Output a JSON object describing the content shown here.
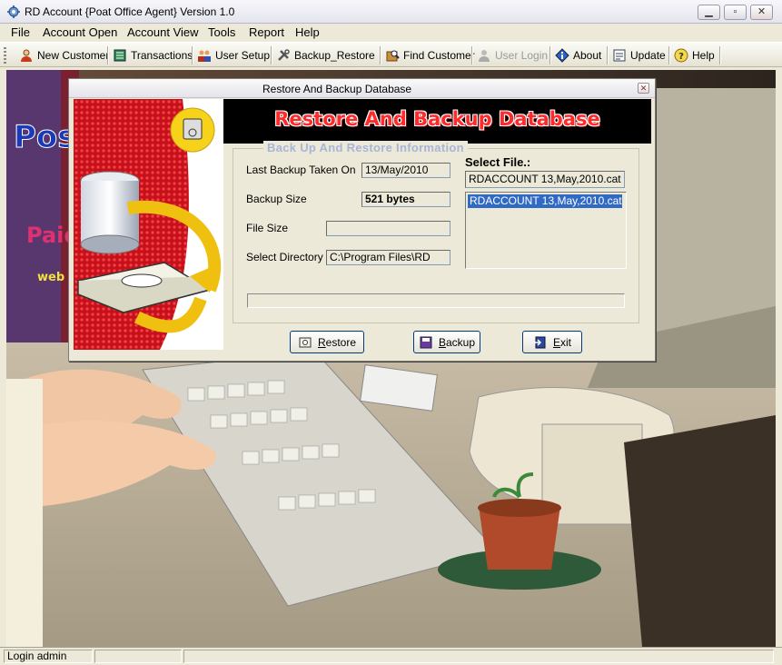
{
  "window": {
    "title": "RD Account {Poat Office Agent} Version 1.0",
    "min_glyph": "▁",
    "max_glyph": "▫",
    "close_glyph": "✕"
  },
  "menu": [
    "File",
    "Account Open",
    "Account View",
    "Tools",
    "Report",
    "Help"
  ],
  "toolbar": [
    {
      "label": "New Customer",
      "icon": "person-icon",
      "enabled": true
    },
    {
      "label": "Transactions",
      "icon": "ledger-icon",
      "enabled": true
    },
    {
      "label": "User Setup",
      "icon": "users-icon",
      "enabled": true
    },
    {
      "label": "Backup_Restore",
      "icon": "tools-icon",
      "enabled": true
    },
    {
      "label": "Find Customer",
      "icon": "find-icon",
      "enabled": true
    },
    {
      "label": "User Login",
      "icon": "user-login-icon",
      "enabled": false
    },
    {
      "label": "About",
      "icon": "info-icon",
      "enabled": true
    },
    {
      "label": "Update",
      "icon": "update-icon",
      "enabled": true
    },
    {
      "label": "Help",
      "icon": "help-icon",
      "enabled": true
    }
  ],
  "background_logo": {
    "line1": "Post",
    "line2": "Paid",
    "line3": "web"
  },
  "dialog": {
    "title": "Restore And Backup Database",
    "close_glyph": "✕",
    "banner": "Restore And Backup Database",
    "group_title": "Back Up And  Restore  Information",
    "fields": {
      "last_backup_label": "Last Backup Taken On",
      "last_backup_value": "13/May/2010",
      "backup_size_label": "Backup Size",
      "backup_size_value": "521 bytes",
      "file_size_label": "File Size",
      "file_size_value": "",
      "select_dir_label": "Select Directory",
      "select_dir_value": "C:\\Program Files\\RD"
    },
    "select_file_label": "Select File.:",
    "selected_file": "RDACCOUNT 13,May,2010.cat",
    "file_list": [
      "RDACCOUNT 13,May,2010.cat"
    ],
    "buttons": {
      "restore_first": "R",
      "restore_rest": "estore",
      "backup_first": "B",
      "backup_rest": "ackup",
      "exit_first": "E",
      "exit_rest": "xit"
    }
  },
  "status": {
    "user": "Login admin",
    "panel2": "",
    "panel3": ""
  },
  "colors": {
    "accent_red": "#ff2b2b",
    "selection_blue": "#316ac5",
    "legend_blue": "#a8b4d8"
  }
}
